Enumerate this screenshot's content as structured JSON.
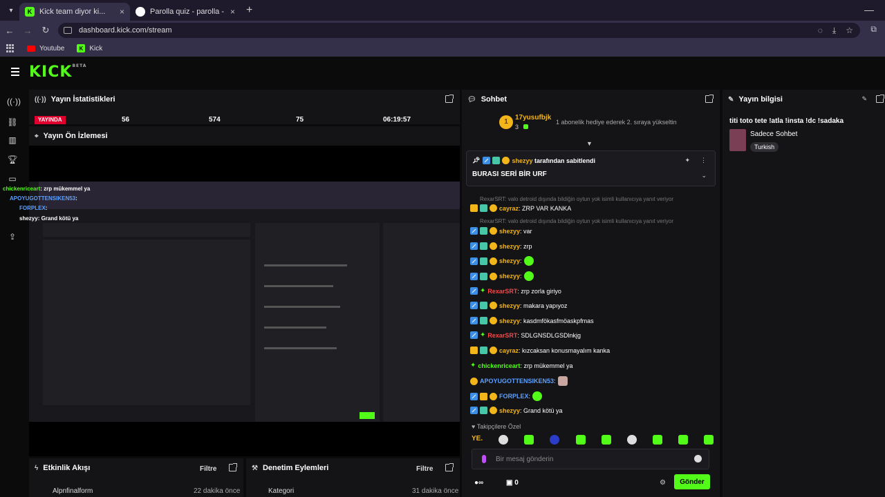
{
  "browser": {
    "tabs": [
      {
        "label": "Kick team diyor ki...",
        "close": "×"
      },
      {
        "label": "Parolla quiz - parolla - Kelime o",
        "close": "×"
      }
    ],
    "new_tab": "+",
    "minimize": "—",
    "url": "dashboard.kick.com/stream",
    "bookmarks": [
      {
        "label": "Youtube"
      },
      {
        "label": "Kick"
      }
    ]
  },
  "header": {
    "logo": "KICK",
    "logo_sup": "BETA"
  },
  "stats_panel": {
    "title": "Yayın İstatistikleri",
    "live_badge": "YAYINDA",
    "values": [
      "56",
      "574",
      "75",
      "06:19:57"
    ]
  },
  "preview_panel": {
    "title": "Yayın Ön İzlemesi",
    "overlay_chat": [
      {
        "user": "chickenriceart",
        "text": ": zrp mükemmel ya"
      },
      {
        "user": "APOYUGOTTENSIKEN53",
        "text": ":"
      },
      {
        "user": "FORPLEX",
        "text": ":"
      },
      {
        "user": "shezyy",
        "text": ": Grand kötü ya"
      }
    ]
  },
  "activity_panel": {
    "title": "Etkinlik Akışı",
    "filter": "Filtre",
    "row_user": "Alpnfinalform",
    "row_time": "22 dakika önce"
  },
  "moderation_panel": {
    "title": "Denetim Eylemleri",
    "filter": "Filtre",
    "row_label": "Kategori",
    "row_time": "31 dakika önce"
  },
  "chat": {
    "title": "Sohbet",
    "gift_user": "17yusufbjk",
    "gift_count": "3",
    "gift_coin": "1",
    "gift_text": "1 abonelik hediye ederek 2. sıraya yükseltin",
    "pinned_by_user": "shezyy",
    "pinned_by_text": "tarafından sabitlendi",
    "pinned_message": "BURASI SERİ BİR URF",
    "messages": [
      {
        "type": "reply",
        "text": "RexarSRT: valo detroid dışında bildiğin oytun yok isimli kullanıcıya yanıt veriyor"
      },
      {
        "type": "msg",
        "user": "cayraz",
        "text": ": ZRP VAR KANKA"
      },
      {
        "type": "reply",
        "text": "RexarSRT: valo detroid dışında bildiğin oytun yok isimli kullanıcıya yanıt veriyor"
      },
      {
        "type": "msg",
        "user": "shezyy",
        "text": ": var"
      },
      {
        "type": "msg",
        "user": "shezyy",
        "text": ": zrp"
      },
      {
        "type": "msg",
        "user": "shezyy",
        "text": ":"
      },
      {
        "type": "msg",
        "user": "shezyy",
        "text": ":"
      },
      {
        "type": "msg",
        "user": "RexarSRT",
        "text": ": zrp zorla giriyo"
      },
      {
        "type": "msg",
        "user": "shezyy",
        "text": ": makara yapıyoz"
      },
      {
        "type": "msg",
        "user": "shezyy",
        "text": ": kasdmfökasfmöaskpfmas"
      },
      {
        "type": "msg",
        "user": "RexarSRT",
        "text": ": SDLGNSDLGSDlnkjg"
      },
      {
        "type": "msg",
        "user": "cayraz",
        "text": ": kızcaksan konusmayalım kanka"
      },
      {
        "type": "msg",
        "user": "chickenriceart",
        "text": ": zrp mükemmel ya"
      },
      {
        "type": "msg",
        "user": "APOYUGOTTENSIKEN53",
        "text": ":"
      },
      {
        "type": "msg",
        "user": "FORPLEX",
        "text": ":"
      },
      {
        "type": "msg",
        "user": "shezyy",
        "text": ": Grand kötü ya"
      }
    ],
    "followers_only": "Takipçilere Özel",
    "emote_label": "YE.",
    "input_placeholder": "Bir mesaj gönderin",
    "points": "∞",
    "points2": "0",
    "send_label": "Gönder"
  },
  "info_panel": {
    "title": "Yayın bilgisi",
    "stream_title": "titi toto tete !atla !insta !dc !sadaka",
    "category": "Sadece Sohbet",
    "tag": "Turkish"
  }
}
